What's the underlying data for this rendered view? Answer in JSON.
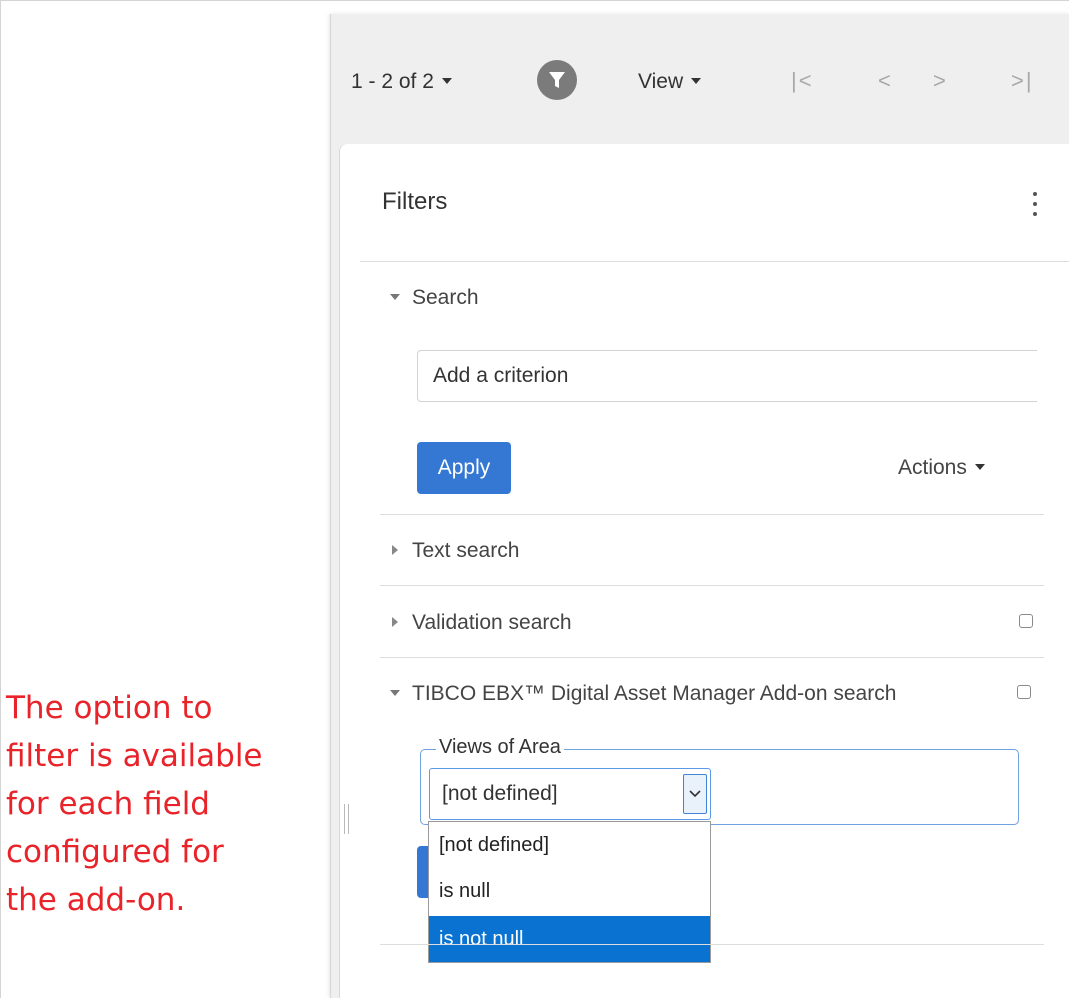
{
  "annotation": {
    "text": "The option to\nfilter is available\nfor each field\nconfigured for\nthe add-on."
  },
  "toolbar": {
    "range_label": "1 - 2 of 2",
    "view_label": "View",
    "nav_first": "|<",
    "nav_prev": "<",
    "nav_next": ">",
    "nav_last": ">|",
    "filter_icon": "filter-funnel-icon"
  },
  "filters": {
    "title": "Filters",
    "menu_icon": "vertical-ellipsis-icon",
    "search": {
      "label": "Search",
      "criterion_text": "Add a criterion",
      "apply_label": "Apply",
      "actions_label": "Actions"
    },
    "sections": [
      {
        "label": "Text search",
        "expanded": false
      },
      {
        "label": "Validation search",
        "expanded": false,
        "checked": false
      },
      {
        "label": "TIBCO EBX™ Digital Asset Manager Add-on search",
        "expanded": true,
        "checked": false
      }
    ],
    "dam_field": {
      "legend": "Views of Area",
      "selected": "[not defined]",
      "options": [
        "[not defined]",
        "is null",
        "is not null"
      ],
      "highlighted_option": "is not null"
    }
  },
  "colors": {
    "annotation_red": "#e8242a",
    "primary_blue": "#3578d3",
    "selection_blue": "#0a73d2",
    "toolbar_bg": "#efefef"
  }
}
